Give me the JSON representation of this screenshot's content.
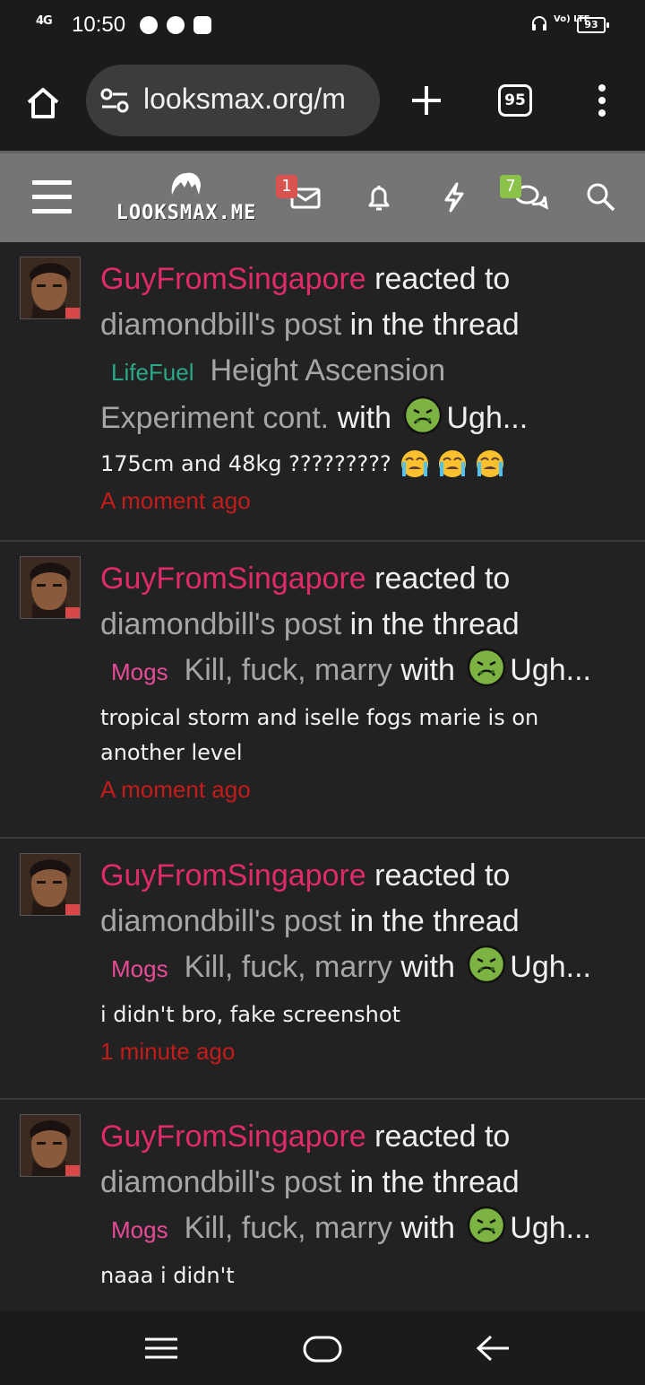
{
  "status_bar": {
    "network": "4G",
    "time": "10:50",
    "volte": "Vo) LTE",
    "battery": "93"
  },
  "browser": {
    "url": "looksmax.org/m",
    "tab_count": "95"
  },
  "site": {
    "logo_text": "LOOKSMAX.ME",
    "inbox_badge": "1",
    "conversations_badge": "7"
  },
  "alerts": [
    {
      "user": "GuyFromSingapore",
      "action": " reacted to",
      "post_ref": "diamondbill's post",
      "thread_phrase": " in the thread",
      "prefix": "LifeFuel",
      "thread_title_1": "Height Ascension",
      "thread_title_2": "Experiment cont.",
      "with_text": " with ",
      "reaction": "Ugh...",
      "snippet": "175cm and 48kg ?????????",
      "time": "A moment ago"
    },
    {
      "user": "GuyFromSingapore",
      "action": " reacted to",
      "post_ref": "diamondbill's post",
      "thread_phrase": " in the thread",
      "prefix": "Mogs",
      "thread_title": "Kill, fuck, marry",
      "with_text": " with ",
      "reaction": "Ugh...",
      "snippet": "tropical storm and iselle fogs marie is on another level",
      "time": "A moment ago"
    },
    {
      "user": "GuyFromSingapore",
      "action": " reacted to",
      "post_ref": "diamondbill's post",
      "thread_phrase": " in the thread",
      "prefix": "Mogs",
      "thread_title": "Kill, fuck, marry",
      "with_text": " with ",
      "reaction": "Ugh...",
      "snippet": "i didn't bro, fake screenshot",
      "time": "1 minute ago"
    },
    {
      "user": "GuyFromSingapore",
      "action": " reacted to",
      "post_ref": "diamondbill's post",
      "thread_phrase": " in the thread",
      "prefix": "Mogs",
      "thread_title": "Kill, fuck, marry",
      "with_text": " with ",
      "reaction": "Ugh...",
      "snippet": "naaa i didn't"
    }
  ],
  "colors": {
    "username": "#e02a6c",
    "timestamp": "#c41b1b",
    "prefix_lifefuel": "#2ba888",
    "prefix_mogs": "#e84b96",
    "header_bg": "#757575",
    "page_bg": "#222222"
  },
  "icons": [
    "home-icon",
    "site-settings-icon",
    "new-tab-icon",
    "tab-switcher-icon",
    "more-icon",
    "menu-icon",
    "inbox-icon",
    "bell-icon",
    "bolt-icon",
    "conversations-icon",
    "search-icon",
    "nauseated-face-icon",
    "crying-face-icon"
  ]
}
